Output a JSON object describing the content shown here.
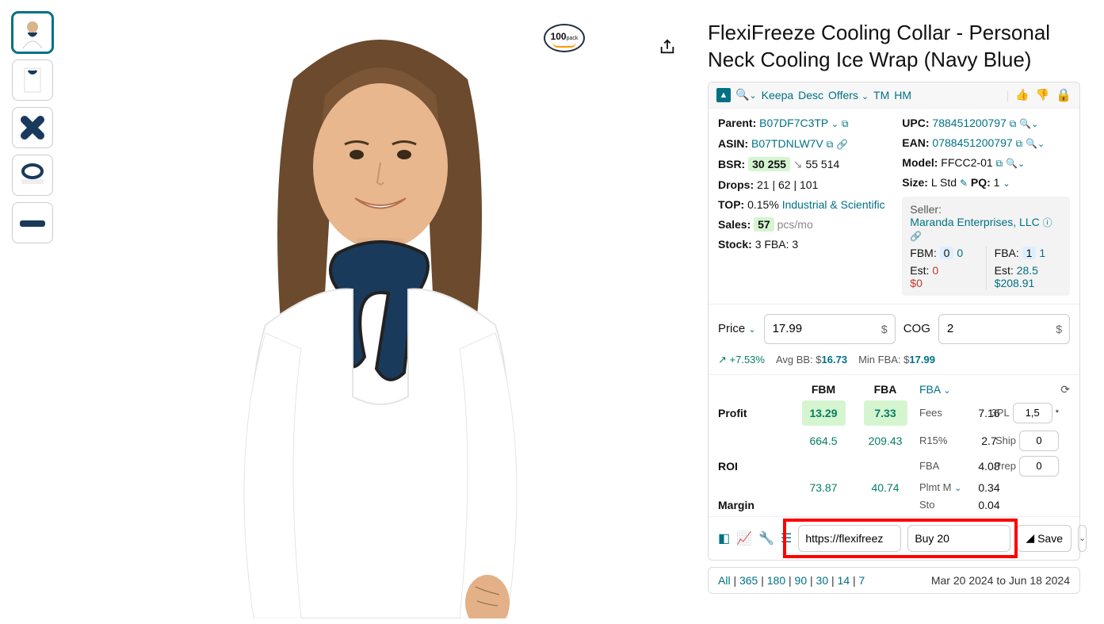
{
  "product": {
    "title": "FlexiFreeze Cooling Collar - Personal Neck Cooling Ice Wrap (Navy Blue)",
    "badge_num": "100",
    "badge_txt": "pack"
  },
  "topbar": {
    "keepa": "Keepa",
    "desc": "Desc",
    "offers": "Offers",
    "tm": "TM",
    "hm": "HM"
  },
  "ids": {
    "parent_lbl": "Parent:",
    "parent": "B07DF7C3TP",
    "asin_lbl": "ASIN:",
    "asin": "B07TDNLW7V",
    "upc_lbl": "UPC:",
    "upc": "788451200797",
    "ean_lbl": "EAN:",
    "ean": "0788451200797",
    "model_lbl": "Model:",
    "model": "FFCC2-01",
    "size_lbl": "Size:",
    "size": "L Std",
    "pq_lbl": "PQ:",
    "pq": "1"
  },
  "metrics": {
    "bsr_lbl": "BSR:",
    "bsr": "30 255",
    "bsr_delta": "55 514",
    "drops_lbl": "Drops:",
    "drops": "21 | 62 | 101",
    "top_lbl": "TOP:",
    "top_pct": "0.15%",
    "top_cat": "Industrial & Scientific",
    "sales_lbl": "Sales:",
    "sales": "57",
    "sales_unit": "pcs/mo",
    "stock_lbl": "Stock:",
    "stock": "3 FBA: 3"
  },
  "seller": {
    "lbl": "Seller:",
    "name": "Maranda Enterprises, LLC",
    "fbm_lbl": "FBM:",
    "fbm_n": "0",
    "fbm_n2": "0",
    "fba_lbl": "FBA:",
    "fba_n": "1",
    "fba_n2": "1",
    "est1_lbl": "Est:",
    "est1_v": "0",
    "est1_v2": "$0",
    "est2_lbl": "Est:",
    "est2_v": "28.5",
    "est2_v2": "$208.91"
  },
  "price": {
    "price_lbl": "Price",
    "price_val": "17.99",
    "cog_lbl": "COG",
    "cog_val": "2",
    "pct": "+7.53%",
    "avgbb_lbl": "Avg BB: $",
    "avgbb": "16.73",
    "minfba_lbl": "Min FBA: $",
    "minfba": "17.99"
  },
  "table": {
    "fbm_hdr": "FBM",
    "fba_hdr": "FBA",
    "fba_sel": "FBA",
    "profit_lbl": "Profit",
    "profit_fbm": "13.29",
    "profit_fba": "7.33",
    "roi_lbl": "ROI",
    "roi_fbm": "664.5",
    "roi_fba": "209.43",
    "margin_lbl": "Margin",
    "margin_fbm": "73.87",
    "margin_fba": "40.74",
    "fees_lbl": "Fees",
    "fees": "7.16",
    "r15_lbl": "R15%",
    "r15": "2.7",
    "fba2_lbl": "FBA",
    "fba2": "4.08",
    "plmt_lbl": "Plmt M",
    "plmt": "0.34",
    "sto_lbl": "Sto",
    "sto": "0.04",
    "tpl_lbl": "3PL",
    "tpl_val": "1,5",
    "ship_lbl": "Ship",
    "ship_val": "0",
    "prep_lbl": "Prep",
    "prep_val": "0"
  },
  "source": {
    "url": "https://flexifreez",
    "note": "Buy 20",
    "save": "Save"
  },
  "dates": {
    "all": "All",
    "d365": "365",
    "d180": "180",
    "d90": "90",
    "d30": "30",
    "d14": "14",
    "d7": "7",
    "range": "Mar 20 2024 to Jun 18 2024"
  }
}
